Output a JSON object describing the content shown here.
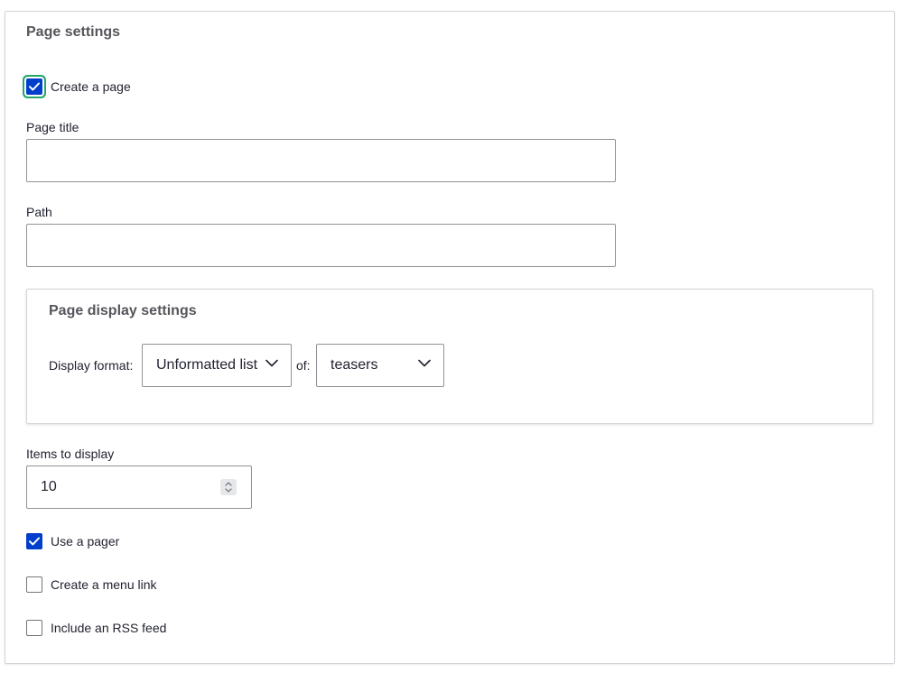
{
  "page_settings": {
    "legend": "Page settings",
    "create_page": {
      "label": "Create a page",
      "checked": true
    },
    "page_title": {
      "label": "Page title",
      "value": ""
    },
    "path": {
      "label": "Path",
      "value": ""
    }
  },
  "page_display_settings": {
    "legend": "Page display settings",
    "display_format_label": "Display format:",
    "display_format_value": "Unformatted list",
    "of_label": "of:",
    "of_value": "teasers"
  },
  "items_to_display": {
    "label": "Items to display",
    "value": "10"
  },
  "options": {
    "use_pager": {
      "label": "Use a pager",
      "checked": true
    },
    "menu_link": {
      "label": "Create a menu link",
      "checked": false
    },
    "rss_feed": {
      "label": "Include an RSS feed",
      "checked": false
    }
  },
  "colors": {
    "accent": "#003ecc",
    "focus": "#26a769",
    "border": "#919297"
  }
}
